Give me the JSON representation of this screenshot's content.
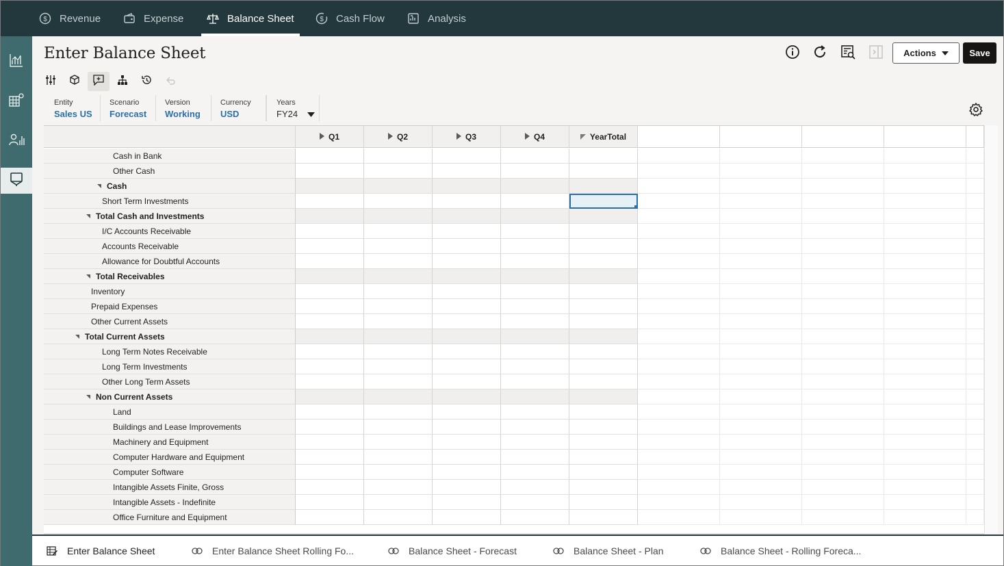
{
  "nav": {
    "tabs": [
      {
        "label": "Revenue",
        "icon": "revenue-icon"
      },
      {
        "label": "Expense",
        "icon": "expense-icon"
      },
      {
        "label": "Balance Sheet",
        "icon": "balance-sheet-icon",
        "active": true
      },
      {
        "label": "Cash Flow",
        "icon": "cash-flow-icon"
      },
      {
        "label": "Analysis",
        "icon": "analysis-icon"
      }
    ]
  },
  "sidebar": {
    "items": [
      {
        "icon": "chart-icon"
      },
      {
        "icon": "grid-icon"
      },
      {
        "icon": "user-chart-icon"
      },
      {
        "icon": "form-icon",
        "active": true
      }
    ]
  },
  "header": {
    "title": "Enter Balance Sheet",
    "actions_label": "Actions",
    "save_label": "Save"
  },
  "pov": {
    "entity_label": "Entity",
    "entity_value": "Sales US",
    "scenario_label": "Scenario",
    "scenario_value": "Forecast",
    "version_label": "Version",
    "version_value": "Working",
    "currency_label": "Currency",
    "currency_value": "USD",
    "years_label": "Years",
    "years_value": "FY24"
  },
  "grid": {
    "columns": [
      "Q1",
      "Q2",
      "Q3",
      "Q4",
      "YearTotal"
    ],
    "rows": [
      {
        "label": "Cash in Bank",
        "level": 3
      },
      {
        "label": "Other Cash",
        "level": 3
      },
      {
        "label": "Cash",
        "level": 2,
        "parent": true
      },
      {
        "label": "Short Term Investments",
        "level": 2
      },
      {
        "label": "Total Cash and Investments",
        "level": 1,
        "parent": true
      },
      {
        "label": "I/C Accounts Receivable",
        "level": 2
      },
      {
        "label": "Accounts Receivable",
        "level": 2
      },
      {
        "label": "Allowance for Doubtful Accounts",
        "level": 2
      },
      {
        "label": "Total Receivables",
        "level": 1,
        "parent": true
      },
      {
        "label": "Inventory",
        "level": 1
      },
      {
        "label": "Prepaid Expenses",
        "level": 1
      },
      {
        "label": "Other Current Assets",
        "level": 1
      },
      {
        "label": "Total Current Assets",
        "level": 0,
        "parent": true
      },
      {
        "label": "Long Term Notes Receivable",
        "level": 2
      },
      {
        "label": "Long Term Investments",
        "level": 2
      },
      {
        "label": "Other Long Term Assets",
        "level": 2
      },
      {
        "label": "Non Current Assets",
        "level": 1,
        "parent": true
      },
      {
        "label": "Land",
        "level": 3
      },
      {
        "label": "Buildings and Lease Improvements",
        "level": 3
      },
      {
        "label": "Machinery and Equipment",
        "level": 3
      },
      {
        "label": "Computer Hardware and Equipment",
        "level": 3
      },
      {
        "label": "Computer Software",
        "level": 3
      },
      {
        "label": "Intangible Assets Finite, Gross",
        "level": 3
      },
      {
        "label": "Intangible Assets - Indefinite",
        "level": 3
      },
      {
        "label": "Office Furniture and Equipment",
        "level": 3
      }
    ]
  },
  "bottom_tabs": [
    {
      "label": "Enter Balance Sheet",
      "active": true
    },
    {
      "label": "Enter Balance Sheet Rolling Fo..."
    },
    {
      "label": "Balance Sheet - Forecast"
    },
    {
      "label": "Balance Sheet - Plan"
    },
    {
      "label": "Balance Sheet - Rolling Foreca..."
    }
  ]
}
